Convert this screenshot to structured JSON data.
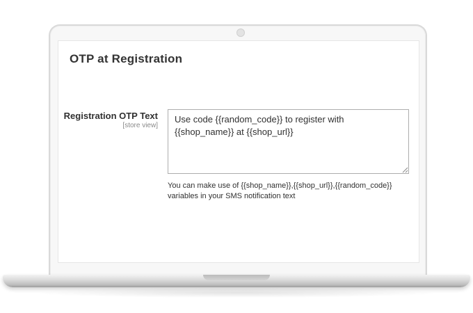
{
  "section": {
    "title": "OTP at Registration"
  },
  "field": {
    "label": "Registration OTP Text",
    "scope": "[store view]",
    "value": "Use code {{random_code}} to register with {{shop_name}} at {{shop_url}}",
    "note_line1": "You can make use of {{shop_name}},{{shop_url}},{{random_code}}",
    "note_line2": "variables in your SMS notification text"
  },
  "colors": {
    "text": "#303030",
    "title": "#333333",
    "scope": "#8a8a8a",
    "border": "#adadad"
  },
  "icons": [
    "camera-icon",
    "resize-grip-icon"
  ]
}
